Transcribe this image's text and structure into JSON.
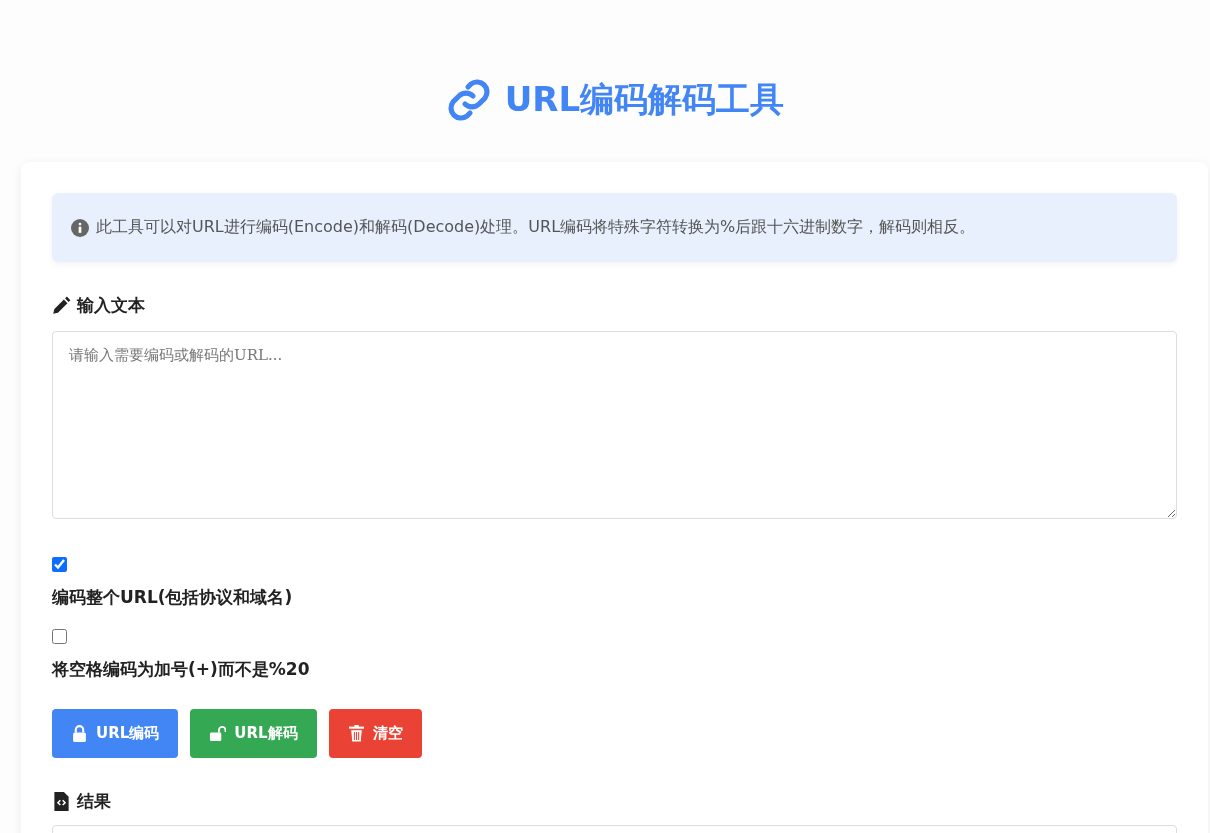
{
  "title": "URL编码解码工具",
  "info": "此工具可以对URL进行编码(Encode)和解码(Decode)处理。URL编码将特殊字符转换为%后跟十六进制数字，解码则相反。",
  "input": {
    "label": "输入文本",
    "placeholder": "请输入需要编码或解码的URL..."
  },
  "options": [
    {
      "label": "编码整个URL(包括协议和域名)",
      "checked": true
    },
    {
      "label": "将空格编码为加号(+)而不是%20",
      "checked": false
    }
  ],
  "buttons": [
    {
      "kind": "encode",
      "label": "URL编码"
    },
    {
      "kind": "decode",
      "label": "URL解码"
    },
    {
      "kind": "clear",
      "label": "清空"
    }
  ],
  "result": {
    "label": "结果"
  }
}
